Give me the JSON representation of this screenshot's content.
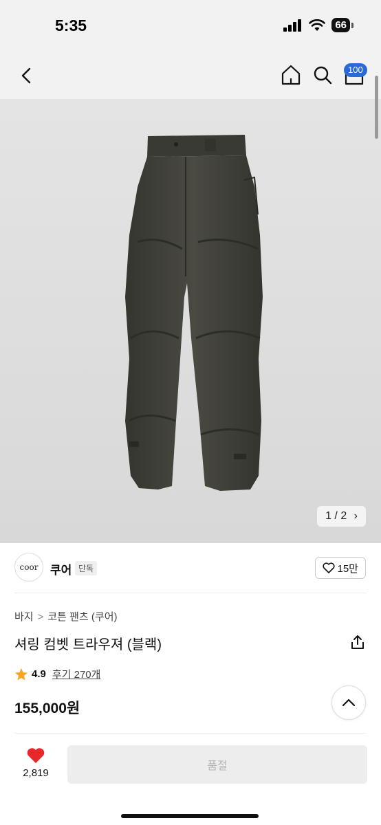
{
  "status_bar": {
    "time": "5:35",
    "battery": "66"
  },
  "header": {
    "cart_badge": "100"
  },
  "gallery": {
    "page_indicator": "1 / 2"
  },
  "brand": {
    "logo_text": "coor",
    "name": "쿠어",
    "tag": "단독",
    "likes": "15만"
  },
  "breadcrumb": {
    "category": "바지",
    "subcategory": "코튼 팬츠 (쿠어)",
    "separator": ">"
  },
  "product": {
    "title": "셔링 컴벳 트라우져 (블랙)",
    "rating": "4.9",
    "reviews": "후기 270개",
    "price": "155,000원"
  },
  "bottom_bar": {
    "heart_count": "2,819",
    "soldout_label": "품절"
  },
  "colors": {
    "accent_blue": "#2a6ad8",
    "heart_red": "#e8272b",
    "star": "#f5a623",
    "pants": "#3f3f39"
  }
}
